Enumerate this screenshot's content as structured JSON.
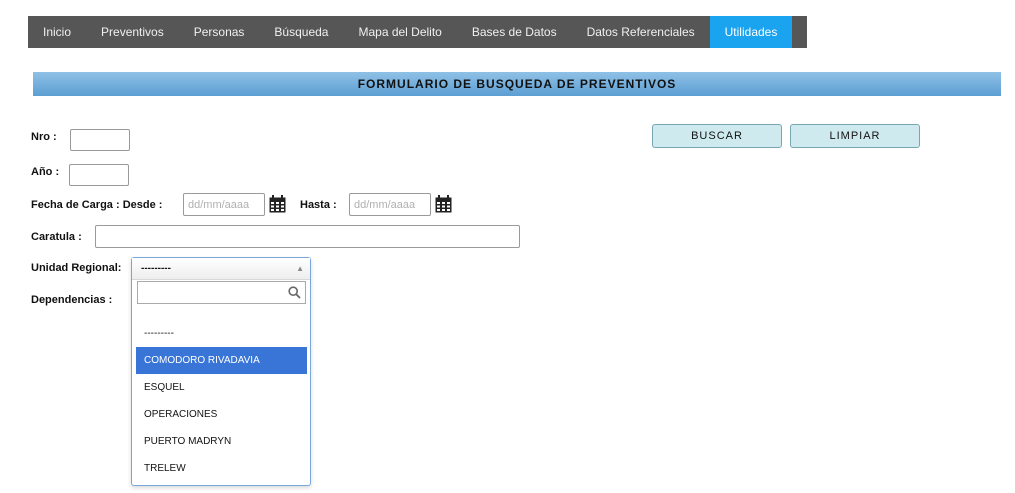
{
  "nav": {
    "items": [
      {
        "label": "Inicio"
      },
      {
        "label": "Preventivos"
      },
      {
        "label": "Personas"
      },
      {
        "label": "Búsqueda"
      },
      {
        "label": "Mapa del Delito"
      },
      {
        "label": "Bases de Datos"
      },
      {
        "label": "Datos Referenciales"
      },
      {
        "label": "Utilidades"
      }
    ],
    "active": "Utilidades",
    "active_color": "#1aa3ef",
    "bar_color": "#565656"
  },
  "form": {
    "title": "FORMULARIO DE BUSQUEDA DE PREVENTIVOS",
    "nro_label": "Nro :",
    "nro_value": "",
    "anio_label": "Año :",
    "anio_value": "",
    "fecha_label": "Fecha de Carga : Desde :",
    "desde_placeholder": "dd/mm/aaaa",
    "hasta_label": "Hasta :",
    "hasta_placeholder": "dd/mm/aaaa",
    "caratula_label": "Caratula :",
    "caratula_value": "",
    "unidad_label": "Unidad Regional:",
    "dependencias_label": "Dependencias :",
    "buscar_label": "BUSCAR",
    "limpiar_label": "LIMPIAR",
    "calendar_icon": "calendar-icon"
  },
  "dropdown": {
    "selected": "---------",
    "search_value": "",
    "search_icon": "magnifier-icon",
    "options": [
      {
        "label": "---------"
      },
      {
        "label": "COMODORO RIVADAVIA"
      },
      {
        "label": "ESQUEL"
      },
      {
        "label": "OPERACIONES"
      },
      {
        "label": "PUERTO MADRYN"
      },
      {
        "label": "TRELEW"
      }
    ],
    "highlighted": "COMODORO RIVADAVIA",
    "highlight_color": "#3875d7"
  }
}
